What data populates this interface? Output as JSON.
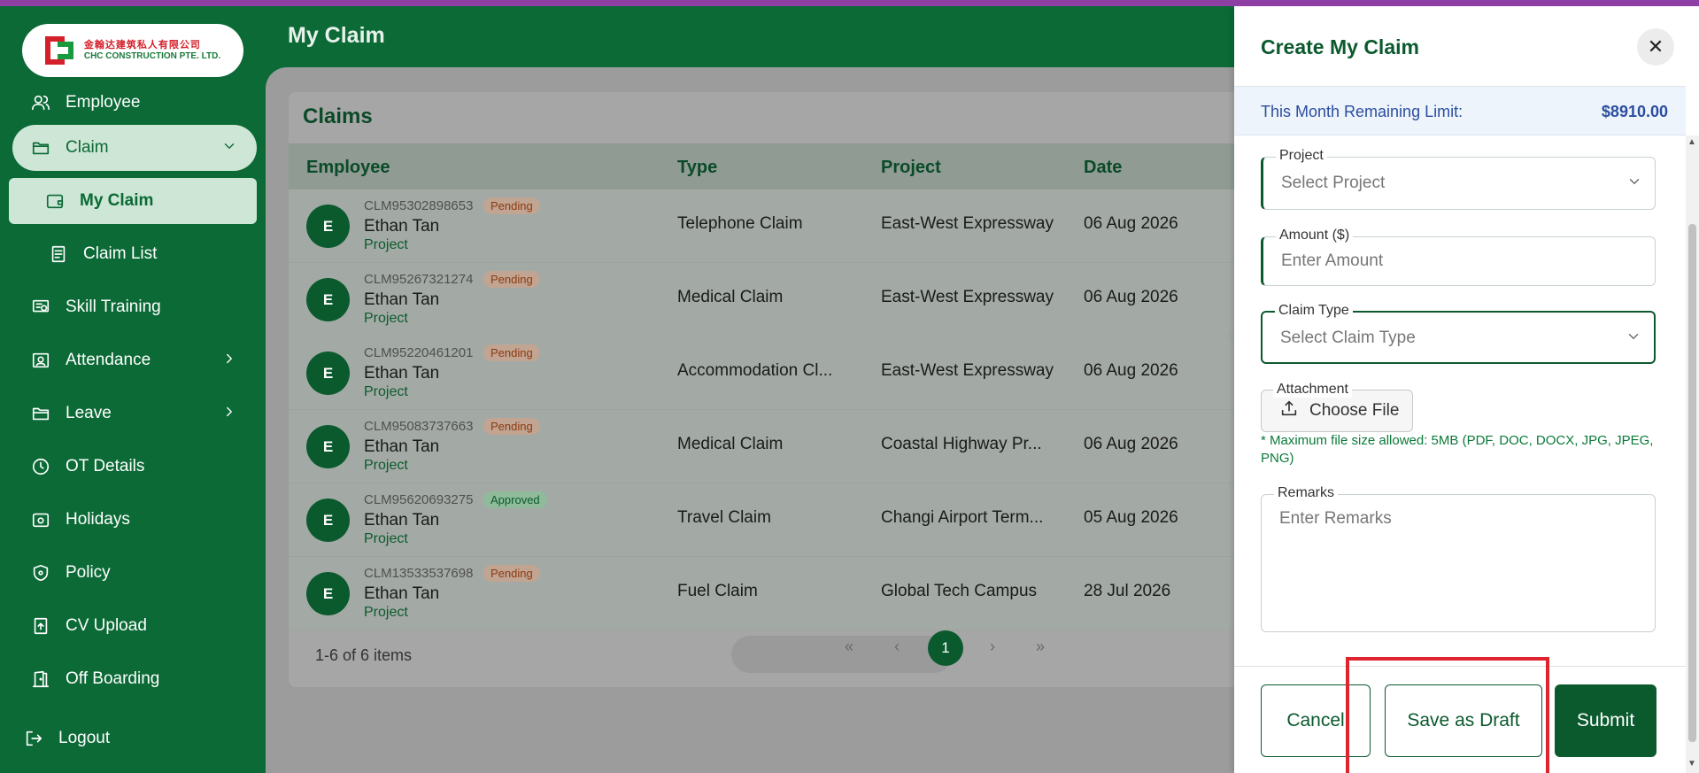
{
  "page": {
    "title": "My Claim"
  },
  "logo": {
    "cn": "金翰达建筑私人有限公司",
    "en": "CHC CONSTRUCTION PTE. LTD."
  },
  "sidebar": {
    "items": [
      {
        "label": "Employee"
      },
      {
        "label": "Claim"
      },
      {
        "label": "My Claim"
      },
      {
        "label": "Claim List"
      },
      {
        "label": "Skill Training"
      },
      {
        "label": "Attendance"
      },
      {
        "label": "Leave"
      },
      {
        "label": "OT Details"
      },
      {
        "label": "Holidays"
      },
      {
        "label": "Policy"
      },
      {
        "label": "CV Upload"
      },
      {
        "label": "Off Boarding"
      },
      {
        "label": "Logout"
      }
    ]
  },
  "claims": {
    "title": "Claims",
    "columns": [
      "Employee",
      "Type",
      "Project",
      "Date"
    ],
    "rows": [
      {
        "initial": "E",
        "id": "CLM95302898653",
        "status": "Pending",
        "name": "Ethan Tan",
        "sub": "Project",
        "type": "Telephone Claim",
        "project": "East-West Expressway",
        "date": "06 Aug 2026"
      },
      {
        "initial": "E",
        "id": "CLM95267321274",
        "status": "Pending",
        "name": "Ethan Tan",
        "sub": "Project",
        "type": "Medical Claim",
        "project": "East-West Expressway",
        "date": "06 Aug 2026"
      },
      {
        "initial": "E",
        "id": "CLM95220461201",
        "status": "Pending",
        "name": "Ethan Tan",
        "sub": "Project",
        "type": "Accommodation Cl...",
        "project": "East-West Expressway",
        "date": "06 Aug 2026"
      },
      {
        "initial": "E",
        "id": "CLM95083737663",
        "status": "Pending",
        "name": "Ethan Tan",
        "sub": "Project",
        "type": "Medical Claim",
        "project": "Coastal Highway Pr...",
        "date": "06 Aug 2026"
      },
      {
        "initial": "E",
        "id": "CLM95620693275",
        "status": "Approved",
        "name": "Ethan Tan",
        "sub": "Project",
        "type": "Travel Claim",
        "project": "Changi Airport Term...",
        "date": "05 Aug 2026"
      },
      {
        "initial": "E",
        "id": "CLM13533537698",
        "status": "Pending",
        "name": "Ethan Tan",
        "sub": "Project",
        "type": "Fuel Claim",
        "project": "Global Tech Campus",
        "date": "28 Jul 2026"
      }
    ],
    "footer": {
      "count": "1-6 of 6 items",
      "first": "«",
      "prev": "‹",
      "page": "1",
      "next": "›",
      "last": "»"
    }
  },
  "drawer": {
    "title": "Create My Claim",
    "close": "✕",
    "limit_label": "This Month Remaining Limit:",
    "limit_value": "$8910.00",
    "project": {
      "label": "Project",
      "placeholder": "Select Project"
    },
    "amount": {
      "label": "Amount ($)",
      "placeholder": "Enter Amount"
    },
    "claim_type": {
      "label": "Claim Type",
      "placeholder": "Select Claim Type"
    },
    "attachment": {
      "label": "Attachment",
      "button": "Choose File"
    },
    "hint": "* Maximum file size allowed: 5MB (PDF, DOC, DOCX, JPG, JPEG, PNG)",
    "remarks": {
      "label": "Remarks",
      "placeholder": "Enter Remarks"
    },
    "buttons": {
      "cancel": "Cancel",
      "draft": "Save as Draft",
      "submit": "Submit"
    }
  },
  "colors": {
    "brand": "#0b6a36",
    "accent": "#0b5a2e",
    "highlight": "#e0242f",
    "limit": "#2b4ea0"
  }
}
